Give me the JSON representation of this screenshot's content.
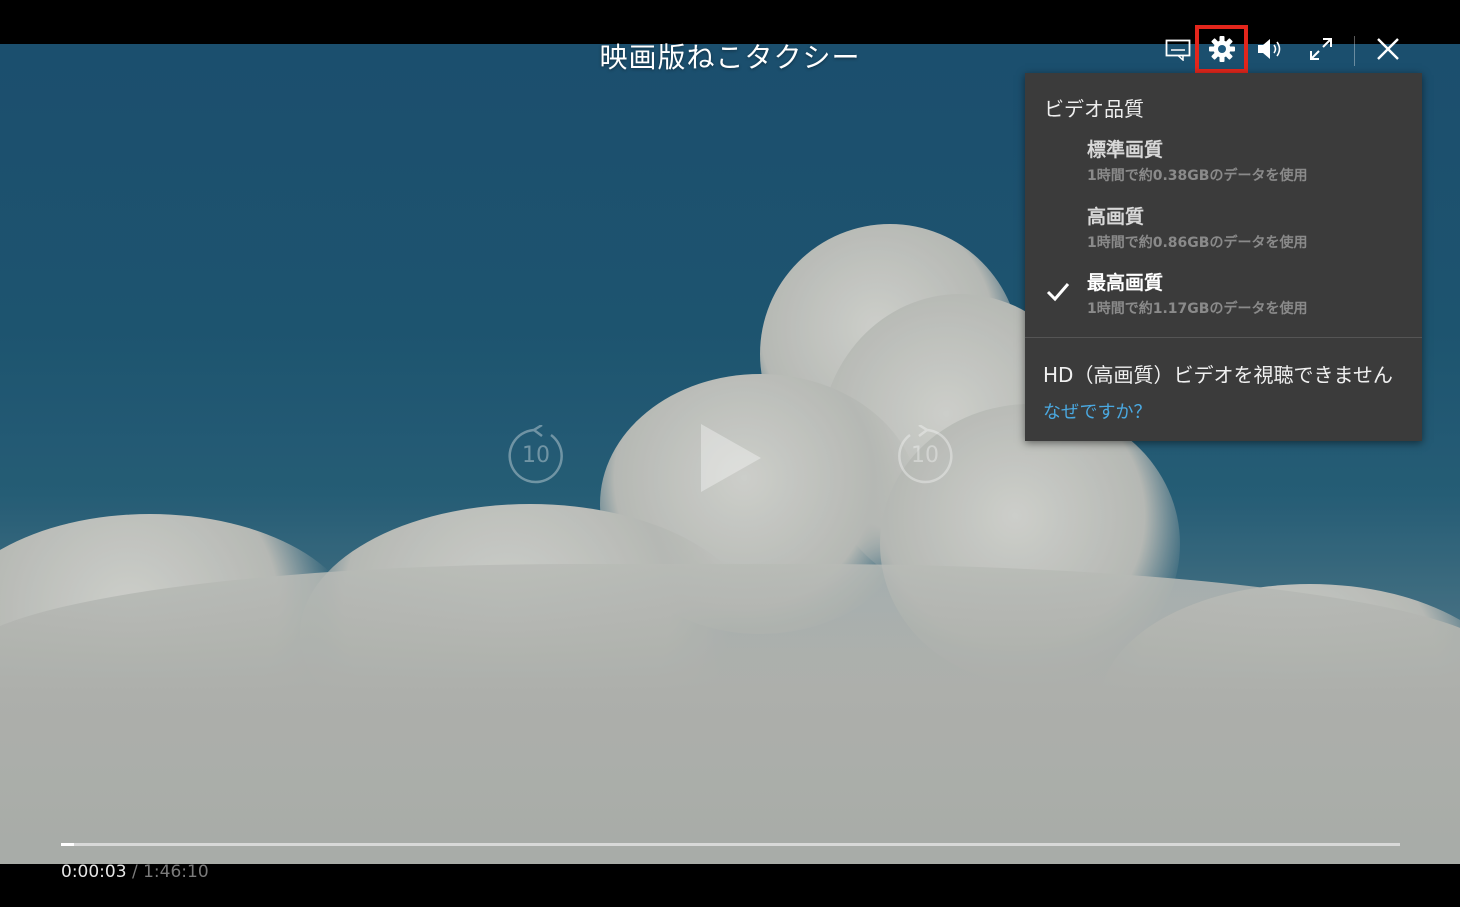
{
  "player": {
    "title": "映画版ねこタクシー",
    "current_time": "0:00:03",
    "separator": "/",
    "duration": "1:46:10",
    "progress_fraction": 0.0005,
    "rewind_seconds": "10",
    "forward_seconds": "10"
  },
  "toolbar": {
    "icons": [
      "subtitles-icon",
      "gear-icon",
      "volume-icon",
      "fullscreen-icon",
      "close-icon"
    ],
    "highlight_color": "#e3261c"
  },
  "settings_menu": {
    "header": "ビデオ品質",
    "options": [
      {
        "label": "標準画質",
        "detail": "1時間で約0.38GBのデータを使用",
        "selected": false
      },
      {
        "label": "高画質",
        "detail": "1時間で約0.86GBのデータを使用",
        "selected": false
      },
      {
        "label": "最高画質",
        "detail": "1時間で約1.17GBのデータを使用",
        "selected": true
      }
    ],
    "hd_notice": "HD（高画質）ビデオを視聴できません",
    "why_link": "なぜですか？",
    "link_color": "#4aa8e0"
  }
}
